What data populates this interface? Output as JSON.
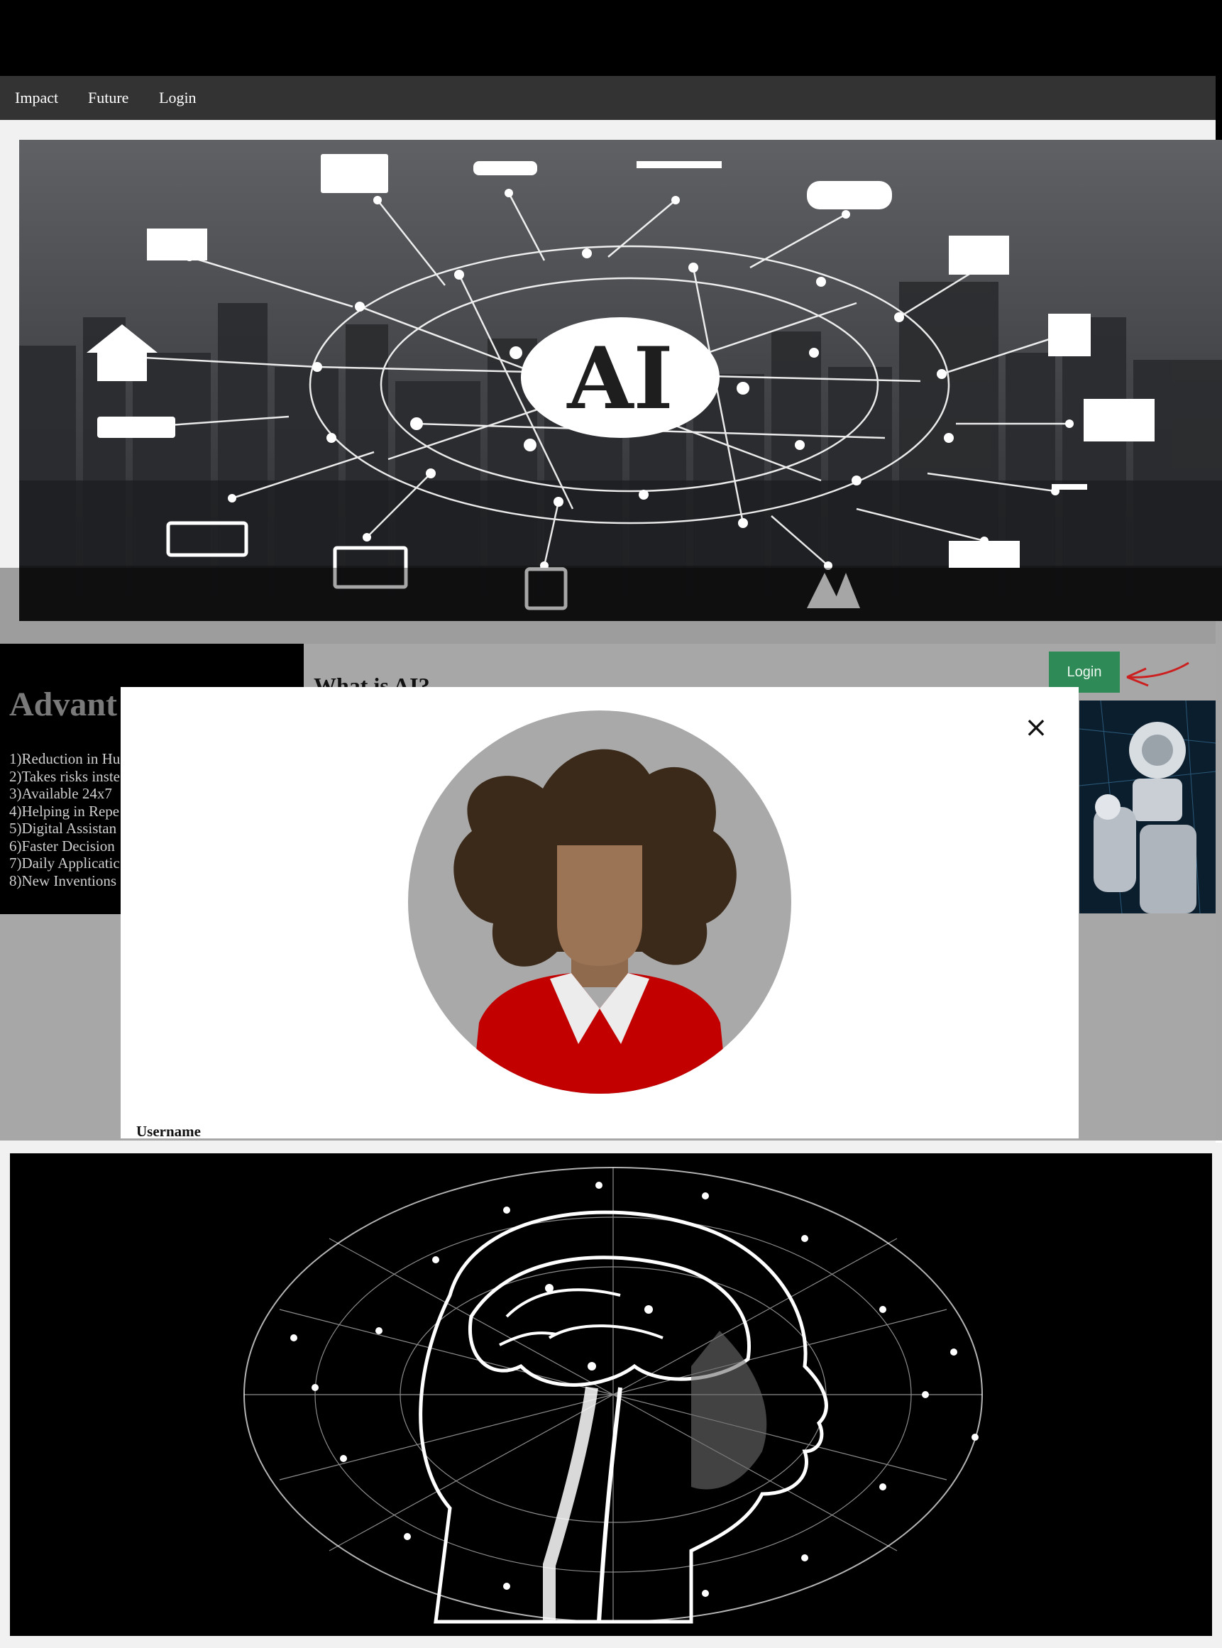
{
  "nav": {
    "items": [
      "Impact",
      "Future",
      "Login"
    ]
  },
  "hero": {
    "center_label": "AI"
  },
  "advantages": {
    "title": "Advant",
    "items": [
      "1)Reduction in Hu",
      "2)Takes risks inste",
      "3)Available 24x7",
      "4)Helping in Repe",
      "5)Digital Assistan",
      "6)Faster Decision",
      "7)Daily Applicatic",
      "8)New Inventions"
    ]
  },
  "main": {
    "title": "What is AI?",
    "login_button": "Login"
  },
  "modal": {
    "close_glyph": "×",
    "username_label": "Username"
  },
  "colors": {
    "nav_bg": "#333333",
    "login_green": "#2e8b57",
    "arrow": "#cc1f1f",
    "shirt": "#c20000"
  }
}
